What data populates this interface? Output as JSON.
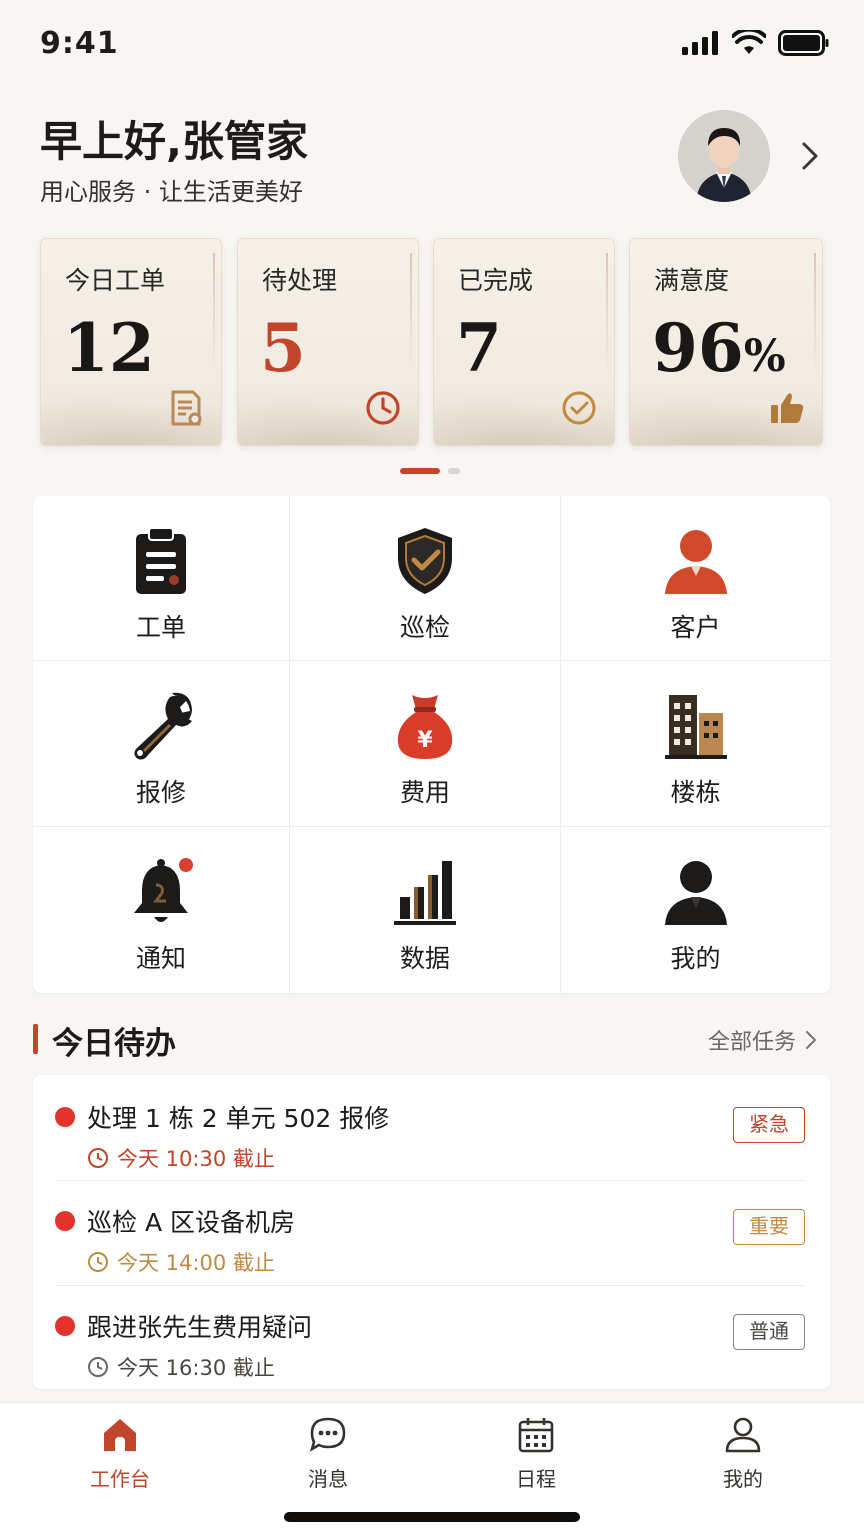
{
  "status": {
    "time": "9:41"
  },
  "header": {
    "greeting": "早上好,张管家",
    "subtitle": "用心服务 · 让生活更美好"
  },
  "stats": [
    {
      "label": "今日工单",
      "value": "12",
      "unit": "",
      "icon": "document-icon"
    },
    {
      "label": "待处理",
      "value": "5",
      "unit": "",
      "icon": "clock-icon"
    },
    {
      "label": "已完成",
      "value": "7",
      "unit": "",
      "icon": "check-circle-icon"
    },
    {
      "label": "满意度",
      "value": "96",
      "unit": "%",
      "icon": "thumbs-up-icon"
    }
  ],
  "stats_pager": {
    "current": 1,
    "total": 2
  },
  "grid": [
    {
      "label": "工单",
      "icon": "clipboard-icon"
    },
    {
      "label": "巡检",
      "icon": "shield-check-icon"
    },
    {
      "label": "客户",
      "icon": "customer-icon"
    },
    {
      "label": "报修",
      "icon": "wrench-icon"
    },
    {
      "label": "费用",
      "icon": "money-bag-icon"
    },
    {
      "label": "楼栋",
      "icon": "building-icon"
    },
    {
      "label": "通知",
      "icon": "bell-icon"
    },
    {
      "label": "数据",
      "icon": "bar-chart-icon"
    },
    {
      "label": "我的",
      "icon": "user-icon"
    }
  ],
  "todo": {
    "title": "今日待办",
    "more": "全部任务",
    "items": [
      {
        "title": "处理 1 栋 2 单元 502 报修",
        "time": "今天 10:30 截止",
        "badge": "紧急",
        "color": "#c0452a"
      },
      {
        "title": "巡检 A 区设备机房",
        "time": "今天 14:00 截止",
        "badge": "重要",
        "color": "#c08a42"
      },
      {
        "title": "跟进张先生费用疑问",
        "time": "今天 16:30 截止",
        "badge": "普通",
        "color": "#6d6863"
      }
    ]
  },
  "tabs": [
    {
      "label": "工作台",
      "icon": "home-icon",
      "active": true
    },
    {
      "label": "消息",
      "icon": "chat-icon",
      "active": false
    },
    {
      "label": "日程",
      "icon": "calendar-icon",
      "active": false
    },
    {
      "label": "我的",
      "icon": "profile-icon",
      "active": false
    }
  ],
  "colors": {
    "accent": "#c0452a",
    "gold": "#c08a42",
    "background": "#f8f6f3"
  }
}
